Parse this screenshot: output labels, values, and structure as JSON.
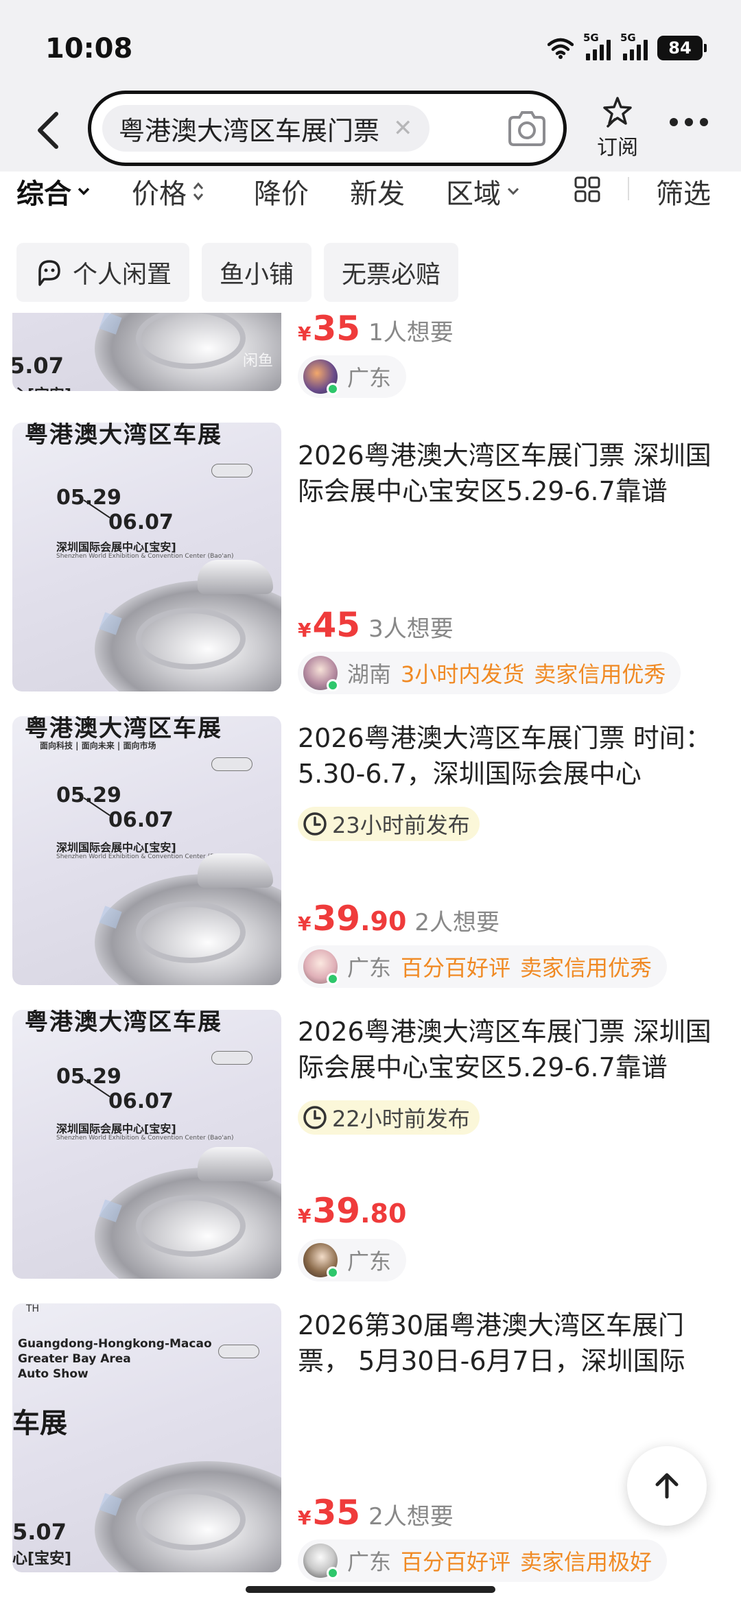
{
  "status": {
    "time": "10:08",
    "signal1": "5G",
    "signal2": "5G",
    "battery": "84"
  },
  "search": {
    "query": "粤港澳大湾区车展门票",
    "subscribe_label": "订阅"
  },
  "filters": [
    {
      "label": "综合"
    },
    {
      "label": "价格"
    },
    {
      "label": "降价"
    },
    {
      "label": "新发"
    },
    {
      "label": "区域"
    },
    {
      "label": "筛选"
    }
  ],
  "tags": [
    {
      "label": "个人闲置"
    },
    {
      "label": "鱼小铺"
    },
    {
      "label": "无票必赔"
    }
  ],
  "items": [
    {
      "title": "",
      "price_int": "35",
      "price_dec": "",
      "currency": "¥",
      "wants": "1人想要",
      "location": "广东",
      "extra1": "",
      "extra2": ""
    },
    {
      "title": "2026粤港澳大湾区车展门票 深圳国际会展中心宝安区5.29-6.7靠谱",
      "price_int": "45",
      "price_dec": "",
      "currency": "¥",
      "wants": "3人想要",
      "location": "湖南",
      "extra1": "3小时内发货",
      "extra2": "卖家信用优秀",
      "thumb": {
        "header": "粤港澳大湾区车展",
        "date1": "05.29",
        "date2": "06.07",
        "venue": "深圳国际会展中心[宝安]",
        "venue_en": "Shenzhen World Exhibition & Convention Center (Bao'an)"
      }
    },
    {
      "title": "2026粤港澳大湾区车展门票 时间：5.30-6.7，深圳国际会展中心",
      "posted": "23小时前发布",
      "price_int": "39",
      "price_dec": ".90",
      "currency": "¥",
      "wants": "2人想要",
      "location": "广东",
      "extra1": "百分百好评",
      "extra2": "卖家信用优秀",
      "thumb": {
        "header": "粤港澳大湾区车展",
        "date1": "05.29",
        "date2": "06.07",
        "venue": "深圳国际会展中心[宝安]",
        "venue_en": "Shenzhen World Exhibition & Convention Center (Bao'an)",
        "sub": "面向科技 | 面向未来 | 面向市场"
      }
    },
    {
      "title": "2026粤港澳大湾区车展门票 深圳国际会展中心宝安区5.29-6.7靠谱",
      "posted": "22小时前发布",
      "price_int": "39",
      "price_dec": ".80",
      "currency": "¥",
      "wants": "",
      "location": "广东",
      "extra1": "",
      "extra2": "",
      "thumb": {
        "header": "粤港澳大湾区车展",
        "date1": "05.29",
        "date2": "06.07",
        "venue": "深圳国际会展中心[宝安]",
        "venue_en": "Shenzhen World Exhibition & Convention Center (Bao'an)"
      }
    },
    {
      "title": "2026第30届粤港澳大湾区车展门票， 5月30日-6月7日，深圳国际",
      "price_int": "35",
      "price_dec": "",
      "currency": "¥",
      "wants": "2人想要",
      "location": "广东",
      "extra1": "百分百好评",
      "extra2": "卖家信用极好",
      "thumb": {
        "en": "Guangdong-Hongkong-Macao\nGreater Bay Area\nAuto Show",
        "cn": "车展",
        "date": "5.07",
        "venue": "心[宝安]"
      }
    }
  ],
  "colors": {
    "price": "#ef3b3b",
    "highlight": "#f08a24",
    "online": "#2ec76b"
  }
}
